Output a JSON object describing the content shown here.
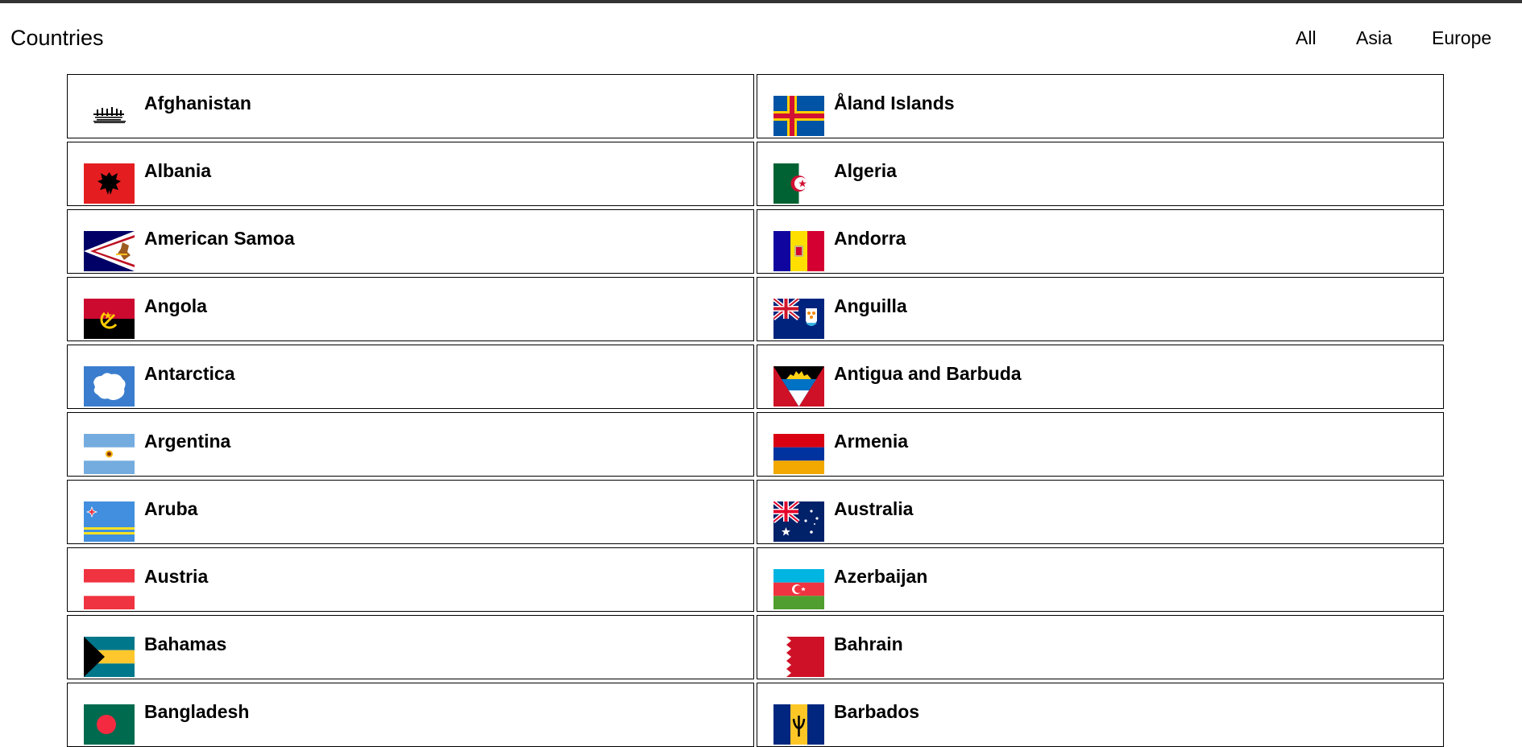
{
  "header": {
    "title": "Countries",
    "nav": [
      "All",
      "Asia",
      "Europe"
    ]
  },
  "countries": [
    {
      "name": "Afghanistan",
      "flag": "afghanistan-flag-icon"
    },
    {
      "name": "Åland Islands",
      "flag": "aland-islands-flag-icon"
    },
    {
      "name": "Albania",
      "flag": "albania-flag-icon"
    },
    {
      "name": "Algeria",
      "flag": "algeria-flag-icon"
    },
    {
      "name": "American Samoa",
      "flag": "american-samoa-flag-icon"
    },
    {
      "name": "Andorra",
      "flag": "andorra-flag-icon"
    },
    {
      "name": "Angola",
      "flag": "angola-flag-icon"
    },
    {
      "name": "Anguilla",
      "flag": "anguilla-flag-icon"
    },
    {
      "name": "Antarctica",
      "flag": "antarctica-flag-icon"
    },
    {
      "name": "Antigua and Barbuda",
      "flag": "antigua-and-barbuda-flag-icon"
    },
    {
      "name": "Argentina",
      "flag": "argentina-flag-icon"
    },
    {
      "name": "Armenia",
      "flag": "armenia-flag-icon"
    },
    {
      "name": "Aruba",
      "flag": "aruba-flag-icon"
    },
    {
      "name": "Australia",
      "flag": "australia-flag-icon"
    },
    {
      "name": "Austria",
      "flag": "austria-flag-icon"
    },
    {
      "name": "Azerbaijan",
      "flag": "azerbaijan-flag-icon"
    },
    {
      "name": "Bahamas",
      "flag": "bahamas-flag-icon"
    },
    {
      "name": "Bahrain",
      "flag": "bahrain-flag-icon"
    },
    {
      "name": "Bangladesh",
      "flag": "bangladesh-flag-icon"
    },
    {
      "name": "Barbados",
      "flag": "barbados-flag-icon"
    }
  ]
}
